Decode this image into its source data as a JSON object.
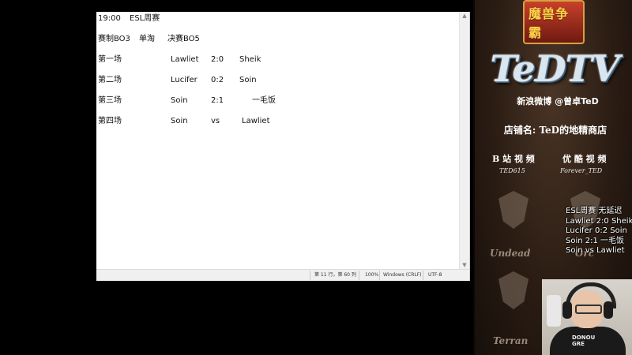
{
  "notepad": {
    "lines": [
      {
        "cells": [
          "19:00",
          "ESL周赛"
        ]
      },
      {
        "cells": []
      },
      {
        "cells": [
          "赛制BO3",
          "单淘",
          "决赛BO5"
        ]
      },
      {
        "cells": []
      },
      {
        "cells": [
          "第一场",
          "Lawliet",
          "2:0",
          "Sheik"
        ]
      },
      {
        "cells": []
      },
      {
        "cells": [
          "第二场",
          "Lucifer",
          "0:2",
          "Soin"
        ]
      },
      {
        "cells": []
      },
      {
        "cells": [
          "第三场",
          "Soin",
          "2:1",
          "一毛饭"
        ]
      },
      {
        "cells": []
      },
      {
        "cells": [
          "第四场",
          "Soin",
          "vs",
          "Lawliet"
        ]
      }
    ],
    "status": {
      "position": "第 11 行，第 60 列",
      "zoom": "100%",
      "line_ending": "Windows (CRLF)",
      "encoding": "UTF-8"
    }
  },
  "panel": {
    "game_logo": "魔兽争霸",
    "brand": "TeDTV",
    "weibo": "新浪微博 @曾卓TeD",
    "shop": "店铺名: TeD的地精商店",
    "bilibili_label": "B 站 视 频",
    "bilibili_id": "TED615",
    "youku_label": "优 酷 视 频",
    "youku_id": "Forever_TED",
    "races": [
      "Undead",
      "Orc",
      "Terran"
    ],
    "score_overlay": [
      "ESL周赛 无延迟",
      "Lawliet 2:0 Sheik",
      "Lucifer 0:2 Soin",
      "Soin 2:1   一毛饭",
      "Soin vs   Lawliet"
    ],
    "webcam_shirt": [
      "DONOU",
      "GRE"
    ]
  },
  "colors": {
    "panel_bg": "#2a1c13",
    "notepad_bg": "#ffffff",
    "text": "#111111"
  }
}
